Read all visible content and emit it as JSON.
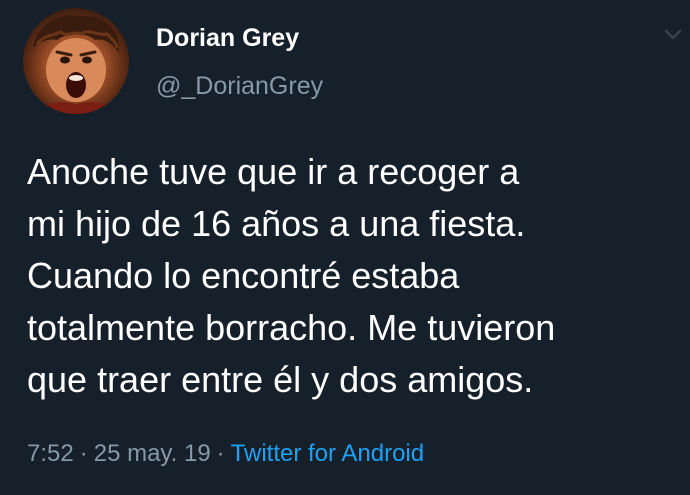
{
  "author": {
    "display_name": "Dorian Grey",
    "handle": "@_DorianGrey",
    "avatar_icon": "profile-photo"
  },
  "tweet": {
    "lines": [
      "Anoche tuve que ir a recoger a",
      "mi hijo de 16 años a una fiesta.",
      "Cuando lo encontré estaba",
      "totalmente borracho. Me tuvieron",
      "que traer entre él y dos amigos."
    ]
  },
  "meta": {
    "time": "7:52",
    "date": "25 may. 19",
    "separator": "·",
    "source": "Twitter for Android"
  },
  "menu": {
    "icon": "chevron-down-icon"
  },
  "colors": {
    "background": "#15202b",
    "primary_text": "#ffffff",
    "secondary_text": "#8899a6",
    "link": "#1da1f2"
  }
}
